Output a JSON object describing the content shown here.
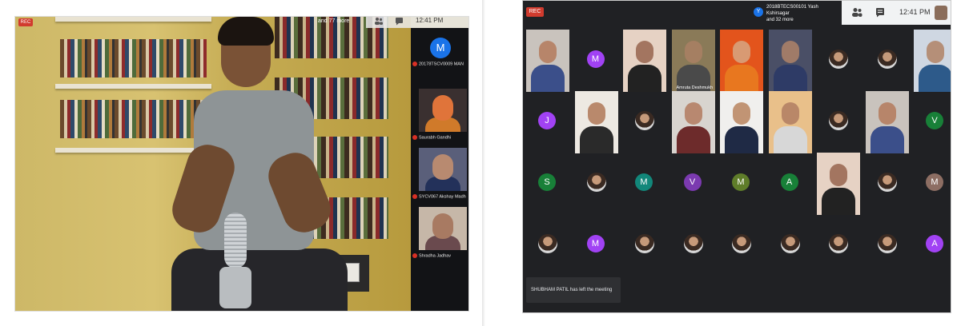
{
  "left": {
    "rec_badge": "REC",
    "participants_text": "and 77 more",
    "time": "12:41 PM",
    "sidebar_avatar_letter": "M",
    "sidebar_names": [
      "20178TSCV0009 MAN",
      "Saurabh Gandhi",
      "SYCV067 Akshay Madh",
      "Shradha Jadhav"
    ],
    "caption": ""
  },
  "right": {
    "rec_badge": "REC",
    "info_avatar": "Y",
    "info_line1": "2018BTECS00101 Yash Kshirsagar",
    "info_line2": "and 32 more",
    "time": "12:41 PM",
    "toast": "SHUBHAM PATIL has left the meeting",
    "tile_label": "Amruta Deshmukh",
    "colors": {
      "purple": "#a142f4",
      "green": "#188038",
      "teal": "#12877a",
      "violet": "#7b3ab0",
      "brown": "#8d6e63",
      "olive": "#5f7d2a"
    },
    "rows": [
      [
        "video",
        "M",
        "video",
        "video",
        "video",
        "video",
        "photo",
        "photo",
        "video"
      ],
      [
        "J",
        "video",
        "photo",
        "video",
        "video",
        "video",
        "photo",
        "video",
        "V"
      ],
      [
        "S",
        "photo",
        "M",
        "V",
        "M",
        "A",
        "video",
        "photo",
        "M"
      ],
      [
        "photo",
        "M",
        "photo",
        "photo",
        "photo",
        "photo",
        "photo",
        "photo",
        "A"
      ]
    ]
  }
}
